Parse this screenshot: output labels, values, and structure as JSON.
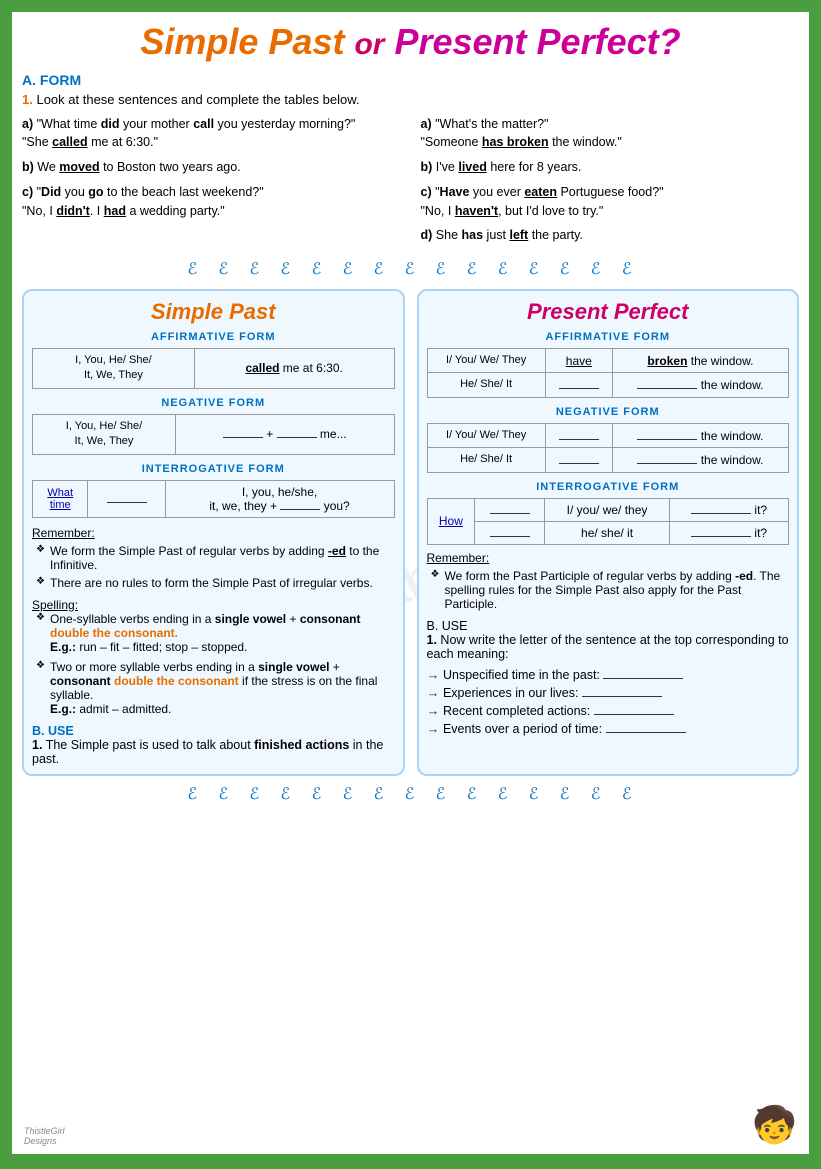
{
  "title": {
    "part1": "Simple Past ",
    "or": "or",
    "part2": " Present Perfect",
    "question": "?"
  },
  "section_a": {
    "label": "A. FORM",
    "instruction_num": "1.",
    "instruction_text": "Look at these sentences and complete the tables below."
  },
  "left_sentences": {
    "a": {
      "label": "a)",
      "text1": "\"What time ",
      "bold1": "did",
      "text2": " your mother ",
      "bold2": "call",
      "text3": " you yesterday morning?\"",
      "text4": "\"She ",
      "bold3": "called",
      "text5": " me at 6:30.\""
    },
    "b": {
      "label": "b)",
      "text1": "We ",
      "bold1": "moved",
      "text2": " to Boston two years ago."
    },
    "c": {
      "label": "c)",
      "text1": "\"",
      "bold1": "Did",
      "text2": " you ",
      "bold2": "go",
      "text3": " to the beach last weekend?\"",
      "text4": "\"No, I ",
      "bold3": "didn't",
      "text5": ". I ",
      "bold4": "had",
      "text6": " a wedding party.\""
    }
  },
  "right_sentences": {
    "a": {
      "label": "a)",
      "text1": "\"What's the matter?\"",
      "text2": "\"Someone ",
      "bold1": "has broken",
      "text3": " the window.\""
    },
    "b": {
      "label": "b)",
      "text1": "I've ",
      "bold1": "lived",
      "text2": " here for 8 years."
    },
    "c": {
      "label": "c)",
      "text1": "\"",
      "bold1": "Have",
      "text2": " you ever ",
      "bold2": "eaten",
      "text3": " Portuguese food?\"",
      "text4": "\"No, I ",
      "bold3": "haven't",
      "text5": ", but I'd love to try.\""
    },
    "d": {
      "label": "d)",
      "text1": "She ",
      "bold1": "has",
      "text2": " just ",
      "bold2": "left",
      "text3": " the party."
    }
  },
  "simple_past": {
    "title": "Simple Past",
    "affirmative_label": "AFFIRMATIVE FORM",
    "affirmative_subject1": "I, You, He/ She/ It, We, They",
    "affirmative_cell1": "called me at 6:30.",
    "affirmative_cell1_underline": "called",
    "negative_label": "NEGATIVE FORM",
    "negative_subject1": "I, You, He/ She/ It, We, They",
    "negative_fill1": "______",
    "negative_plus": "+",
    "negative_fill2": "______",
    "negative_end": "me...",
    "interrogative_label": "INTERROGATIVE FORM",
    "interrog_wh": "What time",
    "interrog_blank": "______",
    "interrog_subject": "I, you, he/she, it, we, they",
    "interrog_plus": "+",
    "interrog_fill": "_____",
    "interrog_end": "you?",
    "remember_title": "Remember:",
    "remember_items": [
      "We form the Simple Past of regular verbs by adding -ed to the Infinitive.",
      "There are no rules to form the Simple Past of irregular verbs."
    ],
    "spelling_title": "Spelling:",
    "spelling_items": [
      "One-syllable verbs ending in a single vowel + consonant double the consonant.\nE.g.: run – fit – fitted; stop – stopped.",
      "Two or more syllable verbs ending in a single vowel + consonant double the consonant if the stress is on the final syllable.\nE.g.: admit – admitted."
    ],
    "b_use_label": "B. USE",
    "b_use_num": "1.",
    "b_use_text": "The Simple past is used to talk about finished actions in the past."
  },
  "present_perfect": {
    "title": "Present Perfect",
    "affirmative_label": "AFFIRMATIVE FORM",
    "aff_subj1": "I/ You/ We/ They",
    "aff_have1": "have",
    "aff_pp1": "broken the window.",
    "aff_pp1_underline": "broken",
    "aff_subj2": "He/ She/ It",
    "aff_have2": "____",
    "aff_pp2": "________ the window.",
    "negative_label": "NEGATIVE FORM",
    "neg_subj1": "I/ You/ We/ They",
    "neg_have1": "________",
    "neg_pp1": "________ the window.",
    "neg_subj2": "He/ She/ It",
    "neg_have2": "________",
    "neg_pp2": "________ the window.",
    "interrogative_label": "INTERROGATIVE FORM",
    "interrog_wh": "How",
    "interrog_blank1": "_____",
    "interrog_subj1": "I/ you/ we/ they",
    "interrog_fill1": "_________ it?",
    "interrog_blank2": "_____",
    "interrog_subj2": "he/ she/ it",
    "interrog_fill2": "_________ it?",
    "remember_title": "Remember:",
    "remember_items": [
      "We form the Past Participle of regular verbs by adding -ed. The spelling rules for the Simple Past also apply for the Past Participle."
    ]
  },
  "section_b_right": {
    "label": "B. USE",
    "num": "1.",
    "instruction": "Now write the letter of the sentence at the top corresponding to each meaning:",
    "items": [
      {
        "arrow": "→",
        "label": "Unspecified time in the past:",
        "blank": "________"
      },
      {
        "arrow": "→",
        "label": "Experiences in our lives:",
        "blank": "________"
      },
      {
        "arrow": "→",
        "label": "Recent completed actions:",
        "blank": "________"
      },
      {
        "arrow": "→",
        "label": "Events over a period of time:",
        "blank": "________"
      }
    ]
  },
  "decorative": {
    "curl_chars": "ℰ ℰ ℰ ℰ ℰ ℰ ℰ ℰ ℰ ℰ ℰ ℰ ℰ ℰ ℰ ℰ"
  },
  "watermark": "ELprintables.com"
}
